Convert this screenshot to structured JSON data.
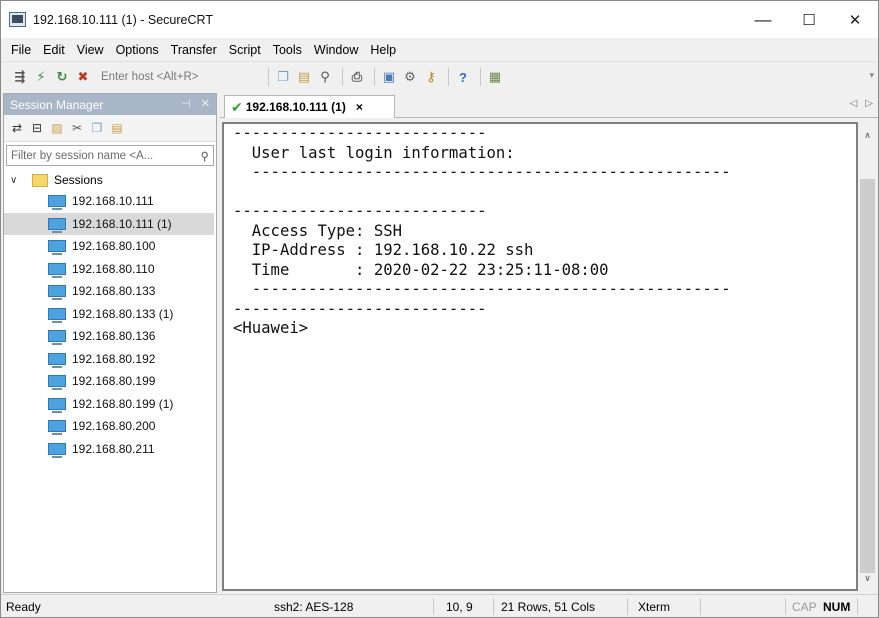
{
  "window": {
    "title": "192.168.10.111 (1) - SecureCRT",
    "controls": {
      "minimize": "—",
      "maximize": "☐",
      "close": "✕"
    }
  },
  "menu": {
    "items": [
      "File",
      "Edit",
      "View",
      "Options",
      "Transfer",
      "Script",
      "Tools",
      "Window",
      "Help"
    ]
  },
  "toolbar": {
    "quick_connect_placeholder": "Enter host <Alt+R>",
    "icons": [
      "connect-icon",
      "quick-connect-icon",
      "reconnect-icon",
      "disconnect-icon",
      "copy-icon",
      "paste-icon",
      "find-icon",
      "print-icon",
      "session-options-icon",
      "global-options-icon",
      "keymap-icon",
      "help-icon",
      "sftp-icon"
    ]
  },
  "session_manager": {
    "title": "Session Manager",
    "filter_placeholder": "Filter by session name <A...",
    "root_label": "Sessions",
    "sessions": [
      "192.168.10.111",
      "192.168.10.111 (1)",
      "192.168.80.100",
      "192.168.80.110",
      "192.168.80.133",
      "192.168.80.133 (1)",
      "192.168.80.136",
      "192.168.80.192",
      "192.168.80.199",
      "192.168.80.199 (1)",
      "192.168.80.200",
      "192.168.80.211"
    ],
    "selected_index": 1
  },
  "tab": {
    "label": "192.168.10.111 (1)",
    "close": "×"
  },
  "terminal": {
    "lines": [
      "---------------------------",
      "  User last login information:",
      "  ---------------------------------------------------",
      "---------------------------",
      "  Access Type: SSH",
      "  IP-Address : 192.168.10.22 ssh",
      "  Time       : 2020-02-22 23:25:11-08:00",
      "  ---------------------------------------------------",
      "---------------------------",
      "<Huawei>"
    ]
  },
  "status": {
    "ready": "Ready",
    "encryption": "ssh2: AES-128",
    "cursor": "10,  9",
    "size": "21 Rows, 51 Cols",
    "emulation": "Xterm",
    "cap": "CAP",
    "num": "NUM"
  },
  "colors": {
    "session_header_bg": "#a9b6c7",
    "selected_row_bg": "#d9d9d9",
    "tab_check": "#2aa33a",
    "session_icon": "#4da3e0"
  }
}
